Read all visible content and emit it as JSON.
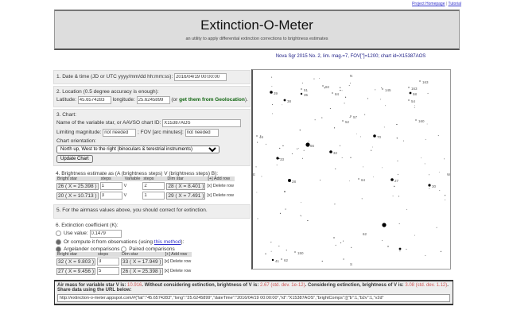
{
  "top_links": {
    "homepage": "Project Homepage",
    "sep": " | ",
    "tutorial": "Tutorial"
  },
  "header": {
    "title": "Extinction-O-Meter",
    "subtitle": "an utility to apply differential extinction corrections to brightness estimates"
  },
  "chart_title": "Nova Sgr 2015 No. 2, lim. mag.=7, FOV['']=1200; chart id=X15387AOS",
  "s1": {
    "label": "1. Date & time (JD or UTC yyyy/mm/dd hh:mm:ss):",
    "value": "2016/04/19 00:00:00"
  },
  "s2": {
    "label": "2. Location (0.5 degree accuracy is enough):",
    "lat_label": "Latitude:",
    "lat": "45.6574283",
    "long_label": "longitude:",
    "long": "25.6245899",
    "geo_pre": "(or ",
    "geo_link": "get them from Geolocation",
    "geo_post": ")."
  },
  "s3": {
    "label": "3. Chart:",
    "name_label": "Name of the variable star, or AAVSO chart ID:",
    "name": "X15387AOS",
    "limmag_label": "Limiting magnitude:",
    "limmag": "not needed",
    "fov_label": "; FOV [arc minutes]:",
    "fov": "not needed",
    "orient_label": "Chart orientation:",
    "orient": "North up, West to the right (binoculars & terestrial instruments)",
    "update": "Update Chart"
  },
  "s4": {
    "label": "4. Brightness estimate as (A (brightness steps) V (brightness steps) B):",
    "headers": [
      "Bright star",
      "steps",
      "Variable",
      "steps",
      "Dim star"
    ],
    "add": "[+] Add row",
    "rows": [
      {
        "bright": "26  ( X = 25.398 )",
        "s1": "1",
        "v": "V",
        "s2": "2",
        "dim": "28  ( X = 8.401 )",
        "del": "[x] Delete row"
      },
      {
        "bright": "20  ( X = 10.713 )",
        "s1": "3",
        "v": "V",
        "s2": "1",
        "dim": "29  ( X = 7.491 )",
        "del": "[x] Delete row"
      }
    ]
  },
  "s5": {
    "label": "5. For the airmass values above, you should correct for extinction."
  },
  "s6": {
    "label": "6. Extinction coefficient (K):",
    "use_value": "Use value:",
    "k": "0.1479",
    "compute_pre": "Or compute it from observations (using ",
    "compute_link": "this method",
    "compute_post": "):",
    "argelander": "Argelander comparisons",
    "paired": "Paired comparisons",
    "headers": [
      "Bright star",
      "steps",
      "Dim star"
    ],
    "add": "[+] Add row",
    "rows": [
      {
        "bright": "32  ( X = 9.803 )",
        "steps": "3",
        "dim": "33  ( X = 17.949 )",
        "del": "[x] Delete row"
      },
      {
        "bright": "27  ( X = 9.456 )",
        "steps": "5",
        "dim": "26  ( X = 25.398 )",
        "del": "[x] Delete row"
      }
    ]
  },
  "result": {
    "p1": "Air mass for variable star V is: ",
    "airmass": "10.916",
    "p2": ". Without considering extinction, brightness of V is: ",
    "b1": "2.67",
    "sd1": " (std. dev. 1e-12)",
    "p3": ". Considering extinction, brightness of V is: ",
    "b2": "3.08",
    "sd2": " (std. dev. 1.12)",
    "p4": ".",
    "share": "Share data using the URL below:",
    "url": "http://extinction-o-meter.appspot.com/#{\"lat\":\"45.6574283\",\"long\":\"25.6245899\",\"dateTime\":\"2016/04/19 00:00:00\",\"id\":\"X15387AOS\",\"brightComps\":[{\"b\":1,\"b2v\":1,\"v2d\""
  },
  "star_labels": [
    "N",
    "S",
    "E",
    "W",
    "39",
    "38",
    "35",
    "51",
    "92",
    "84",
    "145",
    "163",
    "58",
    "54",
    "70",
    "32",
    "66",
    "33",
    "28",
    "27",
    "30",
    "160",
    "57",
    "64",
    "52",
    "150",
    "163",
    "46",
    "41",
    "62",
    "155",
    "62"
  ]
}
